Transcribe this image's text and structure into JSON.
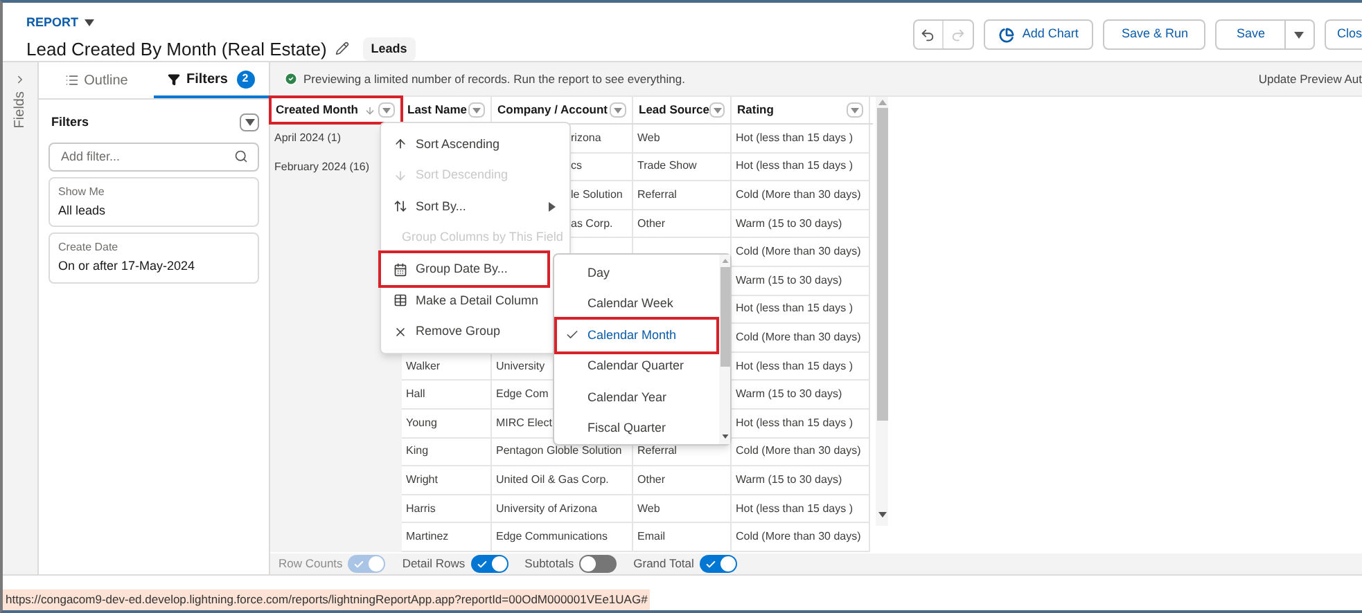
{
  "header": {
    "object_label": "REPORT",
    "title": "Lead Created By Month (Real Estate)",
    "badge": "Leads",
    "undo": {
      "disabled": false
    },
    "redo": {
      "disabled": true
    },
    "buttons": [
      {
        "label": "Add Chart",
        "kind": "chart"
      },
      {
        "label": "Save & Run",
        "kind": "plain"
      },
      {
        "label": "Save",
        "kind": "split"
      },
      {
        "label": "Clos",
        "kind": "plain"
      }
    ]
  },
  "fields_tab": {
    "label": "Fields"
  },
  "left_panel": {
    "tabs": [
      {
        "label": "Outline",
        "selected": false
      },
      {
        "label": "Filters",
        "selected": true,
        "count": "2"
      }
    ],
    "filters_title": "Filters",
    "search": {
      "placeholder": "Add filter..."
    },
    "filters": [
      {
        "label": "Show Me",
        "value": "All leads"
      },
      {
        "label": "Create Date",
        "value": "On or after 17-May-2024"
      }
    ]
  },
  "preview_bar": {
    "message": "Previewing a limited number of records. Run the report to see everything.",
    "action": "Update Preview Aut"
  },
  "table": {
    "columns": [
      {
        "label": "Created Month",
        "sorted": true,
        "highlighted": true
      },
      {
        "label": "Last Name",
        "sorted": false,
        "highlighted": false
      },
      {
        "label": "Company / Account",
        "sorted": false,
        "highlighted": false
      },
      {
        "label": "Lead Source",
        "sorted": false,
        "highlighted": false
      },
      {
        "label": "Rating",
        "sorted": false,
        "highlighted": false
      }
    ],
    "rows": [
      {
        "cells": [
          {
            "text": "April 2024 (1)"
          },
          null,
          {
            "text": "rizona",
            "kind": "cut_left"
          },
          {
            "text": "Web"
          },
          {
            "text": "Hot (less than 15 days )"
          }
        ]
      },
      {
        "cells": [
          {
            "text": "February 2024 (16)"
          },
          null,
          {
            "text": "cs",
            "kind": "cut_left"
          },
          {
            "text": "Trade Show"
          },
          {
            "text": "Hot (less than 15 days )"
          }
        ]
      },
      {
        "cells": [
          null,
          null,
          {
            "text": "le Solution",
            "kind": "cut_left"
          },
          {
            "text": "Referral"
          },
          {
            "text": "Cold (More than 30 days)"
          }
        ]
      },
      {
        "cells": [
          null,
          null,
          {
            "text": "as Corp.",
            "kind": "cut_left"
          },
          {
            "text": "Other"
          },
          {
            "text": "Warm (15 to 30 days)"
          }
        ]
      },
      {
        "cells": [
          null,
          null,
          null,
          null,
          {
            "text": "Cold (More than 30 days)"
          }
        ]
      },
      {
        "cells": [
          null,
          null,
          null,
          null,
          {
            "text": "Warm (15 to 30 days)"
          }
        ]
      },
      {
        "cells": [
          null,
          null,
          null,
          null,
          {
            "text": "Hot (less than 15 days )"
          }
        ]
      },
      {
        "cells": [
          null,
          null,
          null,
          null,
          {
            "text": "Cold (More than 30 days)"
          }
        ]
      },
      {
        "cells": [
          null,
          {
            "text": "Walker"
          },
          {
            "text": "University"
          },
          null,
          {
            "text": "Hot (less than 15 days )"
          }
        ]
      },
      {
        "cells": [
          null,
          {
            "text": "Hall"
          },
          {
            "text": "Edge Com"
          },
          null,
          {
            "text": "Warm (15 to 30 days)"
          }
        ]
      },
      {
        "cells": [
          null,
          {
            "text": "Young"
          },
          {
            "text": "MIRC Elect"
          },
          null,
          {
            "text": "Hot (less than 15 days )"
          }
        ]
      },
      {
        "cells": [
          null,
          {
            "text": "King"
          },
          {
            "text": "Pentagon Globle Solution"
          },
          {
            "text": "Referral"
          },
          {
            "text": "Cold (More than 30 days)"
          }
        ]
      },
      {
        "cells": [
          null,
          {
            "text": "Wright"
          },
          {
            "text": "United Oil & Gas Corp."
          },
          {
            "text": "Other"
          },
          {
            "text": "Warm (15 to 30 days)"
          }
        ]
      },
      {
        "cells": [
          null,
          {
            "text": "Harris"
          },
          {
            "text": "University of Arizona"
          },
          {
            "text": "Web"
          },
          {
            "text": "Hot (less than 15 days )"
          }
        ]
      },
      {
        "cells": [
          null,
          {
            "text": "Martinez"
          },
          {
            "text": "Edge Communications"
          },
          {
            "text": "Email"
          },
          {
            "text": "Cold (More than 30 days)"
          }
        ]
      }
    ]
  },
  "column_menu": {
    "items": [
      {
        "label": "Sort Ascending",
        "disabled": false,
        "highlighted": false,
        "has_submenu": false
      },
      {
        "label": "Sort Descending",
        "disabled": true,
        "highlighted": false,
        "has_submenu": false
      },
      {
        "label": "Sort By...",
        "disabled": false,
        "highlighted": false,
        "has_submenu": true
      },
      {
        "label": "Group Columns by This Field",
        "disabled": true,
        "highlighted": false,
        "has_submenu": false
      },
      {
        "label": "Group Date By...",
        "disabled": false,
        "highlighted": true,
        "has_submenu": true
      },
      {
        "label": "Make a Detail Column",
        "disabled": false,
        "highlighted": false,
        "has_submenu": false
      },
      {
        "label": "Remove Group",
        "disabled": false,
        "highlighted": false,
        "has_submenu": false
      }
    ]
  },
  "group_date_menu": {
    "items": [
      {
        "label": "Day",
        "selected": false,
        "highlighted": false
      },
      {
        "label": "Calendar Week",
        "selected": false,
        "highlighted": false
      },
      {
        "label": "Calendar Month",
        "selected": true,
        "highlighted": true
      },
      {
        "label": "Calendar Quarter",
        "selected": false,
        "highlighted": false
      },
      {
        "label": "Calendar Year",
        "selected": false,
        "highlighted": false
      },
      {
        "label": "Fiscal Quarter",
        "selected": false,
        "highlighted": false
      }
    ]
  },
  "toggles": [
    {
      "label": "Row Counts",
      "on": true,
      "disabled": true
    },
    {
      "label": "Detail Rows",
      "on": true,
      "disabled": false
    },
    {
      "label": "Subtotals",
      "on": false,
      "disabled": false
    },
    {
      "label": "Grand Total",
      "on": true,
      "disabled": false
    }
  ],
  "status_url": "https://congacom9-dev-ed.develop.lightning.force.com/reports/lightningReportApp.app?reportId=00OdM000001VEe1UAG#"
}
